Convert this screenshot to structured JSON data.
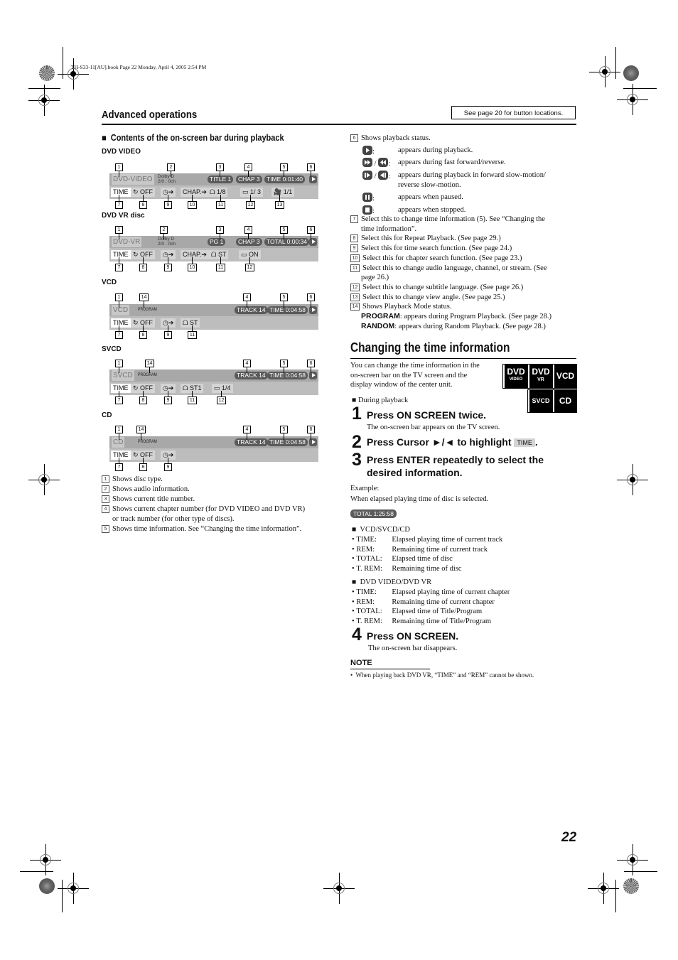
{
  "print_header": "TH-S33-11[AU].book  Page 22  Monday, April 4, 2005  2:54 PM",
  "section_title": "Advanced operations",
  "button_ref": "See page 20 for button locations.",
  "left": {
    "subheading": "Contents of the on-screen bar during playback",
    "bars": [
      {
        "label": "DVD VIDEO",
        "disc": "DVD-VIDEO",
        "audio": [
          "Dolby D",
          "2/0 . 0ch"
        ],
        "mode": "",
        "top_pills": [
          "TITLE  1",
          "CHAP  3",
          "TIME   0:01:40"
        ],
        "row2": [
          "TIME",
          "↻ OFF",
          "◷➔",
          "CHAP.➔",
          "ᗝ 1/8",
          "▭ 1/ 3",
          "🎥 1/1"
        ],
        "callouts_top": [
          "1",
          "2",
          "3",
          "4",
          "5",
          "6"
        ],
        "callouts_bottom": [
          "7",
          "8",
          "9",
          "10",
          "11",
          "12",
          "13"
        ]
      },
      {
        "label": "DVD VR disc",
        "disc": "DVD-VR",
        "audio": [
          "Dolby D",
          "2/0 . 0ch"
        ],
        "mode": "",
        "top_pills": [
          "PG      1",
          "CHAP  3",
          "TOTAL  0:00:34"
        ],
        "row2": [
          "TIME",
          "↻ OFF",
          "◷➔",
          "CHAP.➔",
          "ᗝ ST",
          "▭ ON"
        ],
        "callouts_top": [
          "1",
          "2",
          "3",
          "4",
          "5",
          "6"
        ],
        "callouts_bottom": [
          "7",
          "8",
          "9",
          "10",
          "11",
          "12"
        ]
      },
      {
        "label": "VCD",
        "disc": "VCD",
        "audio": [],
        "mode": "PROGRAM",
        "top_pills": [
          "TRACK 14",
          "TIME   0:04:58"
        ],
        "row2": [
          "TIME",
          "↻ OFF",
          "◷➔",
          "ᗝ ST"
        ],
        "callouts_top": [
          "1",
          "14",
          "4",
          "5",
          "6"
        ],
        "callouts_bottom": [
          "7",
          "8",
          "9",
          "11"
        ]
      },
      {
        "label": "SVCD",
        "disc": "SVCD",
        "audio": [],
        "mode": "PROGRAM",
        "top_pills": [
          "TRACK 14",
          "TIME   0:04:58"
        ],
        "row2": [
          "TIME",
          "↻ OFF",
          "◷➔",
          "ᗝ ST1",
          "▭  1/4"
        ],
        "callouts_top": [
          "1",
          "14",
          "4",
          "5",
          "6"
        ],
        "callouts_bottom": [
          "7",
          "8",
          "9",
          "11",
          "12"
        ]
      },
      {
        "label": "CD",
        "disc": "CD",
        "audio": [],
        "mode": "PROGRAM",
        "top_pills": [
          "TRACK 14",
          "TIME   0:04:58"
        ],
        "row2": [
          "TIME",
          "↻ OFF",
          "◷➔"
        ],
        "callouts_top": [
          "1",
          "14",
          "4",
          "5",
          "6"
        ],
        "callouts_bottom": [
          "7",
          "8",
          "9"
        ]
      }
    ],
    "legend": [
      {
        "n": "1",
        "text": "Shows disc type."
      },
      {
        "n": "2",
        "text": "Shows audio information."
      },
      {
        "n": "3",
        "text": "Shows current title number."
      },
      {
        "n": "4",
        "text": "Shows current chapter number (for DVD VIDEO and DVD VR)",
        "cont": "or track number (for other type of discs)."
      },
      {
        "n": "5",
        "text": "Shows time information. See “Changing the time information”."
      }
    ]
  },
  "right": {
    "item6": {
      "n": "6",
      "text": "Shows playback status."
    },
    "status_icons": [
      {
        "icons": "play-icon",
        "sep": ":",
        "desc": "appears during playback."
      },
      {
        "icons": "fast-forward-reverse-icons",
        "sep": ":",
        "desc": "appears during fast forward/reverse."
      },
      {
        "icons": "slow-motion-icons",
        "sep": ":",
        "desc": "appears during playback in forward slow-motion/",
        "cont": "reverse slow-motion."
      },
      {
        "icons": "pause-icon",
        "sep": ":",
        "desc": "appears when paused."
      },
      {
        "icons": "stop-icon",
        "sep": ":",
        "desc": "appears when stopped."
      }
    ],
    "legend": [
      {
        "n": "7",
        "text": "Select this to change time information (5). See “Changing the",
        "cont": "time information”."
      },
      {
        "n": "8",
        "text": "Select this for Repeat Playback. (See page 29.)"
      },
      {
        "n": "9",
        "text": "Select this for time search function. (See page 24.)"
      },
      {
        "n": "10",
        "text": "Select this for chapter search function. (See page 23.)"
      },
      {
        "n": "11",
        "text": "Select this to change audio language, channel, or stream. (See",
        "cont": "page 26.)"
      },
      {
        "n": "12",
        "text": "Select this to change subtitle language. (See page 26.)"
      },
      {
        "n": "13",
        "text": "Select this to change view angle. (See page 25.)"
      },
      {
        "n": "14",
        "text": "Shows Playback Mode status."
      }
    ],
    "mode_lines": [
      {
        "key": "PROGRAM",
        "text": ": appears during Program Playback. (See page 28.)"
      },
      {
        "key": "RANDOM",
        "text": ": appears during Random Playback. (See page 28.)"
      }
    ],
    "time_section": {
      "title": "Changing the time information",
      "intro": [
        "You can change the time information in the",
        "on-screen bar on the TV screen and the",
        "display window of the center unit."
      ],
      "badges": [
        {
          "main": "DVD",
          "sub": "VIDEO"
        },
        {
          "main": "DVD",
          "sub": "VR"
        },
        {
          "main": "VCD",
          "sub": ""
        },
        {
          "main": "SVCD",
          "sub": ""
        },
        {
          "main": "CD",
          "sub": ""
        }
      ],
      "during": "During playback",
      "steps": [
        {
          "num": "1",
          "text": "Press ON SCREEN twice.",
          "note": "The on-screen bar appears on the TV screen."
        },
        {
          "num": "2",
          "text": "Press Cursor ►/◄ to highlight",
          "highlight": "TIME",
          "tail": "."
        },
        {
          "num": "3",
          "text": "Press ENTER repeatedly to select the",
          "text2": "desired information."
        },
        {
          "num": "4",
          "text": "Press ON SCREEN.",
          "note": "The on-screen bar disappears."
        }
      ],
      "example_label": "Example:",
      "example_text": "When elapsed playing time of disc is selected.",
      "example_display": "TOTAL  1:25:58",
      "groups": [
        {
          "title": "VCD/SVCD/CD",
          "items": [
            {
              "k": "TIME:",
              "v": "Elapsed playing time of current track"
            },
            {
              "k": "REM:",
              "v": "Remaining time of current track"
            },
            {
              "k": "TOTAL:",
              "v": "Elapsed time of disc"
            },
            {
              "k": "T. REM:",
              "v": "Remaining time of disc"
            }
          ]
        },
        {
          "title": "DVD VIDEO/DVD VR",
          "items": [
            {
              "k": "TIME:",
              "v": "Elapsed playing time of current chapter"
            },
            {
              "k": "REM:",
              "v": "Remaining time of current chapter"
            },
            {
              "k": "TOTAL:",
              "v": "Elapsed time of Title/Program"
            },
            {
              "k": "T. REM:",
              "v": "Remaining time of Title/Program"
            }
          ]
        }
      ],
      "note_title": "NOTE",
      "note_text": "When playing back DVD VR, “TIME” and “REM” cannot be shown."
    }
  },
  "page_number": "22"
}
